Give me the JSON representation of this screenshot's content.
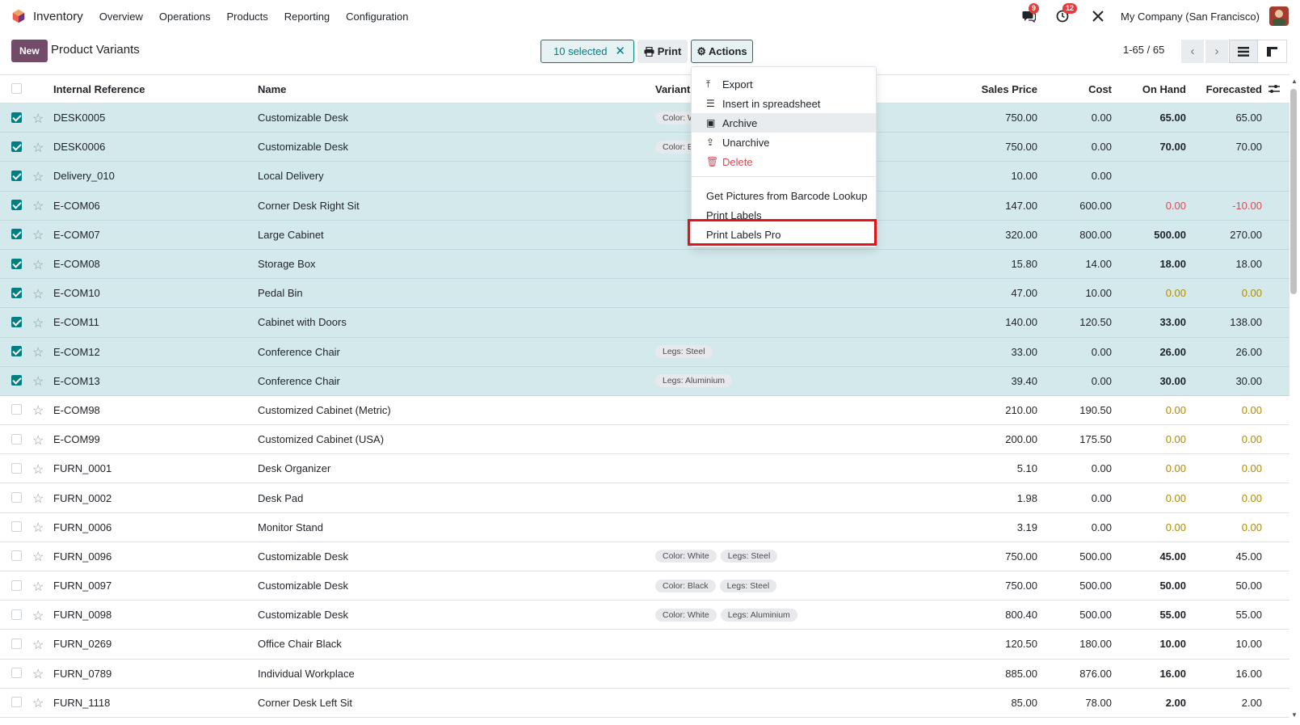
{
  "navbar": {
    "app_name": "Inventory",
    "menu": [
      "Overview",
      "Operations",
      "Products",
      "Reporting",
      "Configuration"
    ],
    "messages_badge": "9",
    "activities_badge": "12",
    "company": "My Company (San Francisco)"
  },
  "control": {
    "new_label": "New",
    "title": "Product Variants",
    "selected_label": "10 selected",
    "print_label": "Print",
    "actions_label": "Actions",
    "pager": "1-65 / 65"
  },
  "columns": {
    "ref": "Internal Reference",
    "name": "Name",
    "variant": "Variant",
    "sales_price": "Sales Price",
    "cost": "Cost",
    "on_hand": "On Hand",
    "forecasted": "Forecasted"
  },
  "rows": [
    {
      "selected": true,
      "ref": "DESK0005",
      "name": "Customizable Desk",
      "tags": [
        "Color: W"
      ],
      "price": "750.00",
      "cost": "0.00",
      "onhand": "65.00",
      "forecast": "65.00",
      "onhand_style": "bold",
      "forecast_style": ""
    },
    {
      "selected": true,
      "ref": "DESK0006",
      "name": "Customizable Desk",
      "tags": [
        "Color: B"
      ],
      "price": "750.00",
      "cost": "0.00",
      "onhand": "70.00",
      "forecast": "70.00",
      "onhand_style": "bold",
      "forecast_style": ""
    },
    {
      "selected": true,
      "ref": "Delivery_010",
      "name": "Local Delivery",
      "tags": [],
      "price": "10.00",
      "cost": "0.00",
      "onhand": "",
      "forecast": "",
      "onhand_style": "",
      "forecast_style": ""
    },
    {
      "selected": true,
      "ref": "E-COM06",
      "name": "Corner Desk Right Sit",
      "tags": [],
      "price": "147.00",
      "cost": "600.00",
      "onhand": "0.00",
      "forecast": "-10.00",
      "onhand_style": "red",
      "forecast_style": "red"
    },
    {
      "selected": true,
      "ref": "E-COM07",
      "name": "Large Cabinet",
      "tags": [],
      "price": "320.00",
      "cost": "800.00",
      "onhand": "500.00",
      "forecast": "270.00",
      "onhand_style": "bold",
      "forecast_style": ""
    },
    {
      "selected": true,
      "ref": "E-COM08",
      "name": "Storage Box",
      "tags": [],
      "price": "15.80",
      "cost": "14.00",
      "onhand": "18.00",
      "forecast": "18.00",
      "onhand_style": "bold",
      "forecast_style": ""
    },
    {
      "selected": true,
      "ref": "E-COM10",
      "name": "Pedal Bin",
      "tags": [],
      "price": "47.00",
      "cost": "10.00",
      "onhand": "0.00",
      "forecast": "0.00",
      "onhand_style": "amber",
      "forecast_style": "amber"
    },
    {
      "selected": true,
      "ref": "E-COM11",
      "name": "Cabinet with Doors",
      "tags": [],
      "price": "140.00",
      "cost": "120.50",
      "onhand": "33.00",
      "forecast": "138.00",
      "onhand_style": "bold",
      "forecast_style": ""
    },
    {
      "selected": true,
      "ref": "E-COM12",
      "name": "Conference Chair",
      "tags": [
        "Legs: Steel"
      ],
      "price": "33.00",
      "cost": "0.00",
      "onhand": "26.00",
      "forecast": "26.00",
      "onhand_style": "bold",
      "forecast_style": ""
    },
    {
      "selected": true,
      "ref": "E-COM13",
      "name": "Conference Chair",
      "tags": [
        "Legs: Aluminium"
      ],
      "price": "39.40",
      "cost": "0.00",
      "onhand": "30.00",
      "forecast": "30.00",
      "onhand_style": "bold",
      "forecast_style": ""
    },
    {
      "selected": false,
      "ref": "E-COM98",
      "name": "Customized Cabinet (Metric)",
      "tags": [],
      "price": "210.00",
      "cost": "190.50",
      "onhand": "0.00",
      "forecast": "0.00",
      "onhand_style": "amber",
      "forecast_style": "amber"
    },
    {
      "selected": false,
      "ref": "E-COM99",
      "name": "Customized Cabinet (USA)",
      "tags": [],
      "price": "200.00",
      "cost": "175.50",
      "onhand": "0.00",
      "forecast": "0.00",
      "onhand_style": "amber",
      "forecast_style": "amber"
    },
    {
      "selected": false,
      "ref": "FURN_0001",
      "name": "Desk Organizer",
      "tags": [],
      "price": "5.10",
      "cost": "0.00",
      "onhand": "0.00",
      "forecast": "0.00",
      "onhand_style": "amber",
      "forecast_style": "amber"
    },
    {
      "selected": false,
      "ref": "FURN_0002",
      "name": "Desk Pad",
      "tags": [],
      "price": "1.98",
      "cost": "0.00",
      "onhand": "0.00",
      "forecast": "0.00",
      "onhand_style": "amber",
      "forecast_style": "amber"
    },
    {
      "selected": false,
      "ref": "FURN_0006",
      "name": "Monitor Stand",
      "tags": [],
      "price": "3.19",
      "cost": "0.00",
      "onhand": "0.00",
      "forecast": "0.00",
      "onhand_style": "amber",
      "forecast_style": "amber"
    },
    {
      "selected": false,
      "ref": "FURN_0096",
      "name": "Customizable Desk",
      "tags": [
        "Color: White",
        "Legs: Steel"
      ],
      "price": "750.00",
      "cost": "500.00",
      "onhand": "45.00",
      "forecast": "45.00",
      "onhand_style": "bold",
      "forecast_style": ""
    },
    {
      "selected": false,
      "ref": "FURN_0097",
      "name": "Customizable Desk",
      "tags": [
        "Color: Black",
        "Legs: Steel"
      ],
      "price": "750.00",
      "cost": "500.00",
      "onhand": "50.00",
      "forecast": "50.00",
      "onhand_style": "bold",
      "forecast_style": ""
    },
    {
      "selected": false,
      "ref": "FURN_0098",
      "name": "Customizable Desk",
      "tags": [
        "Color: White",
        "Legs: Aluminium"
      ],
      "price": "800.40",
      "cost": "500.00",
      "onhand": "55.00",
      "forecast": "55.00",
      "onhand_style": "bold",
      "forecast_style": ""
    },
    {
      "selected": false,
      "ref": "FURN_0269",
      "name": "Office Chair Black",
      "tags": [],
      "price": "120.50",
      "cost": "180.00",
      "onhand": "10.00",
      "forecast": "10.00",
      "onhand_style": "bold",
      "forecast_style": ""
    },
    {
      "selected": false,
      "ref": "FURN_0789",
      "name": "Individual Workplace",
      "tags": [],
      "price": "885.00",
      "cost": "876.00",
      "onhand": "16.00",
      "forecast": "16.00",
      "onhand_style": "bold",
      "forecast_style": ""
    },
    {
      "selected": false,
      "ref": "FURN_1118",
      "name": "Corner Desk Left Sit",
      "tags": [],
      "price": "85.00",
      "cost": "78.00",
      "onhand": "2.00",
      "forecast": "2.00",
      "onhand_style": "bold",
      "forecast_style": ""
    }
  ],
  "actions_menu": {
    "items": [
      {
        "label": "Export",
        "icon": "upload-icon",
        "style": ""
      },
      {
        "label": "Insert in spreadsheet",
        "icon": "list-icon",
        "style": ""
      },
      {
        "label": "Archive",
        "icon": "archive-icon",
        "style": "hover"
      },
      {
        "label": "Unarchive",
        "icon": "unarchive-icon",
        "style": ""
      },
      {
        "label": "Delete",
        "icon": "trash-icon",
        "style": "danger"
      }
    ],
    "extra_items": [
      {
        "label": "Get Pictures from Barcode Lookup"
      },
      {
        "label": "Print Labels"
      },
      {
        "label": "Print Labels Pro"
      }
    ]
  },
  "colors": {
    "brand": "#714b67",
    "accent": "#017e84",
    "selected_row": "#d4e9ec",
    "danger": "#d44c59",
    "warning": "#b18b00",
    "highlight_box": "#e0131a"
  }
}
